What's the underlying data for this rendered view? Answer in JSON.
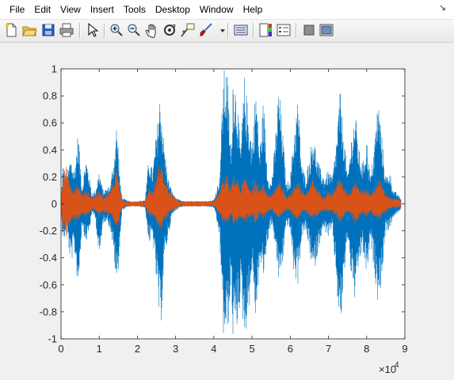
{
  "menu": [
    "File",
    "Edit",
    "View",
    "Insert",
    "Tools",
    "Desktop",
    "Window",
    "Help"
  ],
  "menu_corner_icon": "dock-arrow-icon",
  "toolbar": {
    "buttons": [
      {
        "name": "new-figure-icon"
      },
      {
        "name": "open-file-icon"
      },
      {
        "name": "save-figure-icon"
      },
      {
        "name": "print-figure-icon"
      },
      {
        "name": "edit-plot-cursor-icon"
      },
      {
        "name": "zoom-in-icon"
      },
      {
        "name": "zoom-out-icon"
      },
      {
        "name": "pan-hand-icon"
      },
      {
        "name": "rotate-3d-icon"
      },
      {
        "name": "data-cursor-icon"
      },
      {
        "name": "brush-icon"
      },
      {
        "name": "brush-dropdown-icon"
      },
      {
        "name": "link-plot-icon"
      },
      {
        "name": "insert-colorbar-icon"
      },
      {
        "name": "insert-legend-icon"
      },
      {
        "name": "hide-plot-tools-icon"
      },
      {
        "name": "show-plot-tools-icon"
      }
    ]
  },
  "colors": {
    "series1": "#0072bd",
    "series2": "#d95319",
    "figure_bg": "#f0f0f0",
    "axes_bg": "#ffffff"
  },
  "chart_data": {
    "type": "line",
    "title": "",
    "xlabel": "",
    "ylabel": "",
    "xlim": [
      0,
      90000
    ],
    "ylim": [
      -1,
      1
    ],
    "x_exponent_label": "×10",
    "x_exponent_power": "4",
    "xticks": [
      0,
      10000,
      20000,
      30000,
      40000,
      50000,
      60000,
      70000,
      80000,
      90000
    ],
    "xtick_labels": [
      "0",
      "1",
      "2",
      "3",
      "4",
      "5",
      "6",
      "7",
      "8",
      "9"
    ],
    "yticks": [
      1,
      0.8,
      0.6,
      0.4,
      0.2,
      0,
      -0.2,
      -0.4,
      -0.6,
      -0.8,
      -1
    ],
    "ytick_labels": [
      "1",
      "0.8",
      "0.6",
      "0.4",
      "0.2",
      "0",
      "-0.2",
      "-0.4",
      "-0.6",
      "-0.8",
      "-1"
    ],
    "grid": false,
    "legend": "none",
    "series": [
      {
        "color": "#0072bd",
        "envelope_x": [
          0,
          500,
          1500,
          2500,
          3500,
          4500,
          5500,
          6500,
          7500,
          8000,
          9000,
          10000,
          11000,
          12000,
          13000,
          14000,
          14500,
          15000,
          15500,
          16000,
          17000,
          18000,
          20000,
          22000,
          23000,
          24000,
          25000,
          26000,
          27000,
          28000,
          29000,
          30000,
          31000,
          32000,
          33000,
          35000,
          38000,
          40000,
          41500,
          42500,
          43500,
          44000,
          44500,
          45000,
          46000,
          47000,
          48000,
          49000,
          50000,
          51000,
          52000,
          53000,
          54000,
          55000,
          56000,
          57000,
          58000,
          59000,
          60000,
          61000,
          62000,
          63000,
          64000,
          65000,
          66000,
          67000,
          68000,
          69000,
          70000,
          71000,
          72000,
          73000,
          74000,
          75000,
          76000,
          77000,
          78000,
          79000,
          80000,
          81000,
          82000,
          83000,
          84000,
          85000,
          86000,
          87000,
          88000,
          89000
        ],
        "envelope_upper": [
          0.03,
          0.3,
          0.2,
          0.35,
          0.25,
          0.55,
          0.12,
          0.35,
          0.2,
          0.08,
          0.1,
          0.25,
          0.1,
          0.12,
          0.15,
          0.4,
          0.6,
          0.45,
          0.15,
          0.05,
          0.03,
          0.02,
          0.02,
          0.03,
          0.35,
          0.25,
          0.55,
          0.85,
          0.45,
          0.2,
          0.1,
          0.05,
          0.03,
          0.02,
          0.02,
          0.02,
          0.02,
          0.03,
          0.2,
          1.0,
          1.0,
          0.7,
          0.35,
          1.0,
          0.85,
          0.4,
          0.95,
          0.7,
          0.45,
          0.9,
          0.4,
          0.8,
          0.25,
          0.15,
          0.45,
          0.9,
          0.55,
          0.15,
          0.2,
          0.55,
          0.8,
          0.3,
          0.2,
          0.35,
          0.55,
          0.35,
          0.25,
          0.2,
          0.25,
          0.2,
          0.45,
          0.85,
          0.55,
          0.2,
          0.5,
          0.7,
          0.4,
          0.3,
          0.5,
          0.2,
          0.45,
          0.8,
          0.5,
          0.2,
          0.25,
          0.1,
          0.08,
          0.04
        ],
        "envelope_lower": [
          -0.03,
          -0.3,
          -0.2,
          -0.45,
          -0.35,
          -0.65,
          -0.15,
          -0.3,
          -0.2,
          -0.08,
          -0.1,
          -0.45,
          -0.15,
          -0.12,
          -0.2,
          -0.45,
          -0.65,
          -0.5,
          -0.25,
          -0.05,
          -0.03,
          -0.02,
          -0.02,
          -0.03,
          -0.3,
          -0.25,
          -0.6,
          -1.0,
          -0.45,
          -0.25,
          -0.1,
          -0.05,
          -0.03,
          -0.02,
          -0.02,
          -0.02,
          -0.02,
          -0.03,
          -0.25,
          -1.0,
          -1.0,
          -0.85,
          -0.6,
          -1.0,
          -0.95,
          -0.7,
          -1.0,
          -0.85,
          -0.5,
          -0.9,
          -0.45,
          -0.55,
          -0.3,
          -0.15,
          -0.3,
          -0.6,
          -0.45,
          -0.15,
          -0.2,
          -0.55,
          -0.6,
          -0.25,
          -0.2,
          -0.35,
          -0.55,
          -0.4,
          -0.25,
          -0.2,
          -0.25,
          -0.2,
          -0.55,
          -1.0,
          -0.6,
          -0.25,
          -0.55,
          -0.75,
          -0.45,
          -0.35,
          -0.55,
          -0.3,
          -0.5,
          -0.75,
          -0.55,
          -0.2,
          -0.2,
          -0.1,
          -0.08,
          -0.04
        ]
      },
      {
        "color": "#d95319",
        "envelope_x": [
          0,
          500,
          1500,
          2500,
          3500,
          4500,
          5500,
          6500,
          7500,
          8000,
          9000,
          10000,
          11000,
          12000,
          13000,
          14000,
          14500,
          15000,
          15500,
          16000,
          17000,
          18000,
          20000,
          22000,
          23000,
          24000,
          25000,
          26000,
          27000,
          28000,
          29000,
          30000,
          31000,
          32000,
          33000,
          35000,
          38000,
          40000,
          41500,
          42500,
          43500,
          44000,
          44500,
          45000,
          46000,
          47000,
          48000,
          49000,
          50000,
          51000,
          52000,
          53000,
          54000,
          55000,
          56000,
          57000,
          58000,
          59000,
          60000,
          61000,
          62000,
          63000,
          64000,
          65000,
          66000,
          67000,
          68000,
          69000,
          70000,
          71000,
          72000,
          73000,
          74000,
          75000,
          76000,
          77000,
          78000,
          79000,
          80000,
          81000,
          82000,
          83000,
          84000,
          85000,
          86000,
          87000,
          88000,
          89000
        ],
        "envelope_upper": [
          0.02,
          0.22,
          0.3,
          0.15,
          0.12,
          0.15,
          0.08,
          0.1,
          0.08,
          0.05,
          0.08,
          0.1,
          0.06,
          0.08,
          0.1,
          0.2,
          0.3,
          0.25,
          0.1,
          0.03,
          0.02,
          0.02,
          0.02,
          0.02,
          0.12,
          0.1,
          0.2,
          0.35,
          0.2,
          0.12,
          0.08,
          0.04,
          0.02,
          0.02,
          0.02,
          0.02,
          0.02,
          0.02,
          0.1,
          0.2,
          0.22,
          0.15,
          0.1,
          0.22,
          0.2,
          0.12,
          0.2,
          0.15,
          0.12,
          0.18,
          0.1,
          0.15,
          0.08,
          0.06,
          0.12,
          0.2,
          0.12,
          0.06,
          0.08,
          0.12,
          0.2,
          0.1,
          0.08,
          0.12,
          0.2,
          0.12,
          0.08,
          0.06,
          0.1,
          0.08,
          0.15,
          0.2,
          0.15,
          0.08,
          0.12,
          0.2,
          0.12,
          0.1,
          0.12,
          0.08,
          0.12,
          0.2,
          0.15,
          0.08,
          0.05,
          0.04,
          0.04,
          0.03
        ],
        "envelope_lower": [
          -0.02,
          -0.2,
          -0.25,
          -0.15,
          -0.12,
          -0.12,
          -0.08,
          -0.1,
          -0.06,
          -0.05,
          -0.06,
          -0.1,
          -0.06,
          -0.08,
          -0.08,
          -0.15,
          -0.25,
          -0.2,
          -0.1,
          -0.03,
          -0.02,
          -0.02,
          -0.02,
          -0.02,
          -0.1,
          -0.08,
          -0.15,
          -0.2,
          -0.15,
          -0.1,
          -0.06,
          -0.04,
          -0.02,
          -0.02,
          -0.02,
          -0.02,
          -0.02,
          -0.02,
          -0.08,
          -0.15,
          -0.15,
          -0.12,
          -0.08,
          -0.15,
          -0.15,
          -0.1,
          -0.15,
          -0.12,
          -0.1,
          -0.15,
          -0.08,
          -0.12,
          -0.06,
          -0.05,
          -0.08,
          -0.12,
          -0.1,
          -0.05,
          -0.06,
          -0.1,
          -0.12,
          -0.08,
          -0.06,
          -0.1,
          -0.12,
          -0.1,
          -0.06,
          -0.05,
          -0.08,
          -0.06,
          -0.1,
          -0.15,
          -0.1,
          -0.06,
          -0.1,
          -0.15,
          -0.1,
          -0.08,
          -0.1,
          -0.06,
          -0.1,
          -0.12,
          -0.1,
          -0.06,
          -0.04,
          -0.03,
          -0.03,
          -0.02
        ]
      }
    ]
  }
}
